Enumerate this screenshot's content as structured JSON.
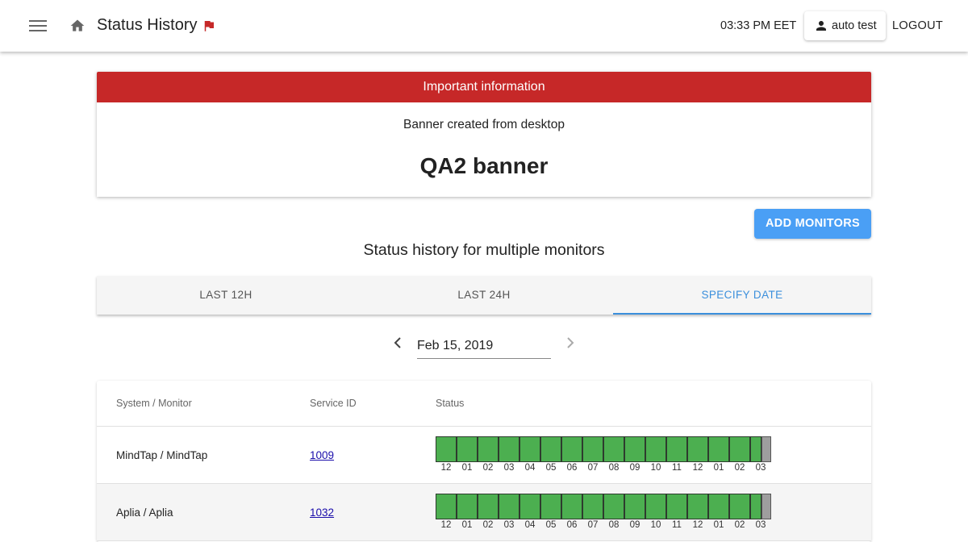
{
  "header": {
    "title": "Status History",
    "time": "03:33 PM EET",
    "user": "auto test",
    "logout": "LOGOUT",
    "icons": [
      "menu-icon",
      "home-icon",
      "flag-icon",
      "person-icon"
    ],
    "flag_color": "#c62828"
  },
  "banner": {
    "heading": "Important information",
    "subtitle": "Banner created from desktop",
    "main": "QA2 banner",
    "heading_color": "#c62828"
  },
  "add_monitors": "ADD MONITORS",
  "section_title": "Status history for multiple monitors",
  "tabs": [
    {
      "label": "LAST 12H",
      "active": false
    },
    {
      "label": "LAST 24H",
      "active": false
    },
    {
      "label": "SPECIFY DATE",
      "active": true
    }
  ],
  "date": {
    "value": "Feb 15, 2019"
  },
  "table": {
    "headers": {
      "system": "System / Monitor",
      "service": "Service ID",
      "status": "Status"
    },
    "hour_labels": [
      "12",
      "01",
      "02",
      "03",
      "04",
      "05",
      "06",
      "07",
      "08",
      "09",
      "10",
      "11",
      "12",
      "01",
      "02",
      "03"
    ],
    "rows": [
      {
        "system": "MindTap / MindTap",
        "service_id": "1009",
        "status": "up",
        "status_color": "#4caf50",
        "pending_color": "#9e9e9e"
      },
      {
        "system": "Aplia / Aplia",
        "service_id": "1032",
        "status": "up",
        "status_color": "#4caf50",
        "pending_color": "#9e9e9e"
      }
    ]
  },
  "accent_color": "#3b8fdc"
}
